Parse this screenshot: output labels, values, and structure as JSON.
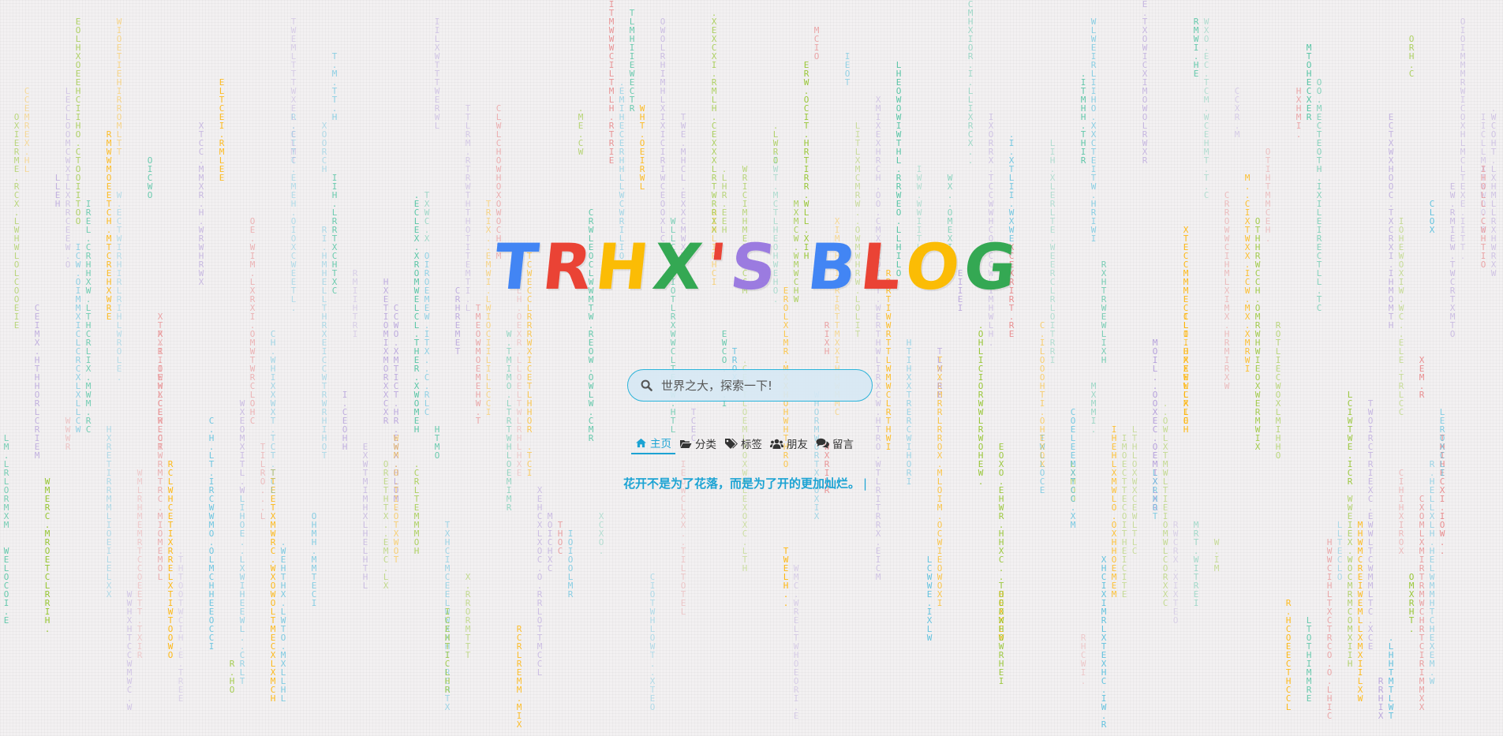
{
  "logo": {
    "letters": [
      {
        "ch": "T",
        "color": "#4285f4"
      },
      {
        "ch": "R",
        "color": "#ea4335"
      },
      {
        "ch": "H",
        "color": "#fbbc05"
      },
      {
        "ch": "X",
        "color": "#34a853"
      },
      {
        "ch": "'",
        "color": "#ea4335"
      },
      {
        "ch": "S",
        "color": "#9b7be0"
      },
      {
        "ch": " ",
        "color": "#000000"
      },
      {
        "ch": "B",
        "color": "#4285f4"
      },
      {
        "ch": "L",
        "color": "#ea4335"
      },
      {
        "ch": "O",
        "color": "#fbbc05"
      },
      {
        "ch": "G",
        "color": "#34a853"
      }
    ]
  },
  "search": {
    "placeholder": "世界之大，探索一下!",
    "icon": "search-icon"
  },
  "nav": {
    "items": [
      {
        "label": "主页",
        "icon": "home-icon",
        "active": true
      },
      {
        "label": "分类",
        "icon": "folder-open-icon",
        "active": false
      },
      {
        "label": "标签",
        "icon": "tags-icon",
        "active": false
      },
      {
        "label": "朋友",
        "icon": "users-icon",
        "active": false
      },
      {
        "label": "留言",
        "icon": "comments-icon",
        "active": false
      }
    ]
  },
  "motto": {
    "text": "花开不是为了花落，而是为了开的更加灿烂。",
    "cursor": "|"
  },
  "colors": {
    "accent": "#1ca3d3",
    "background": "#f3f1f2",
    "rain_palette": [
      "#8dc21f",
      "#5bc0de",
      "#e8888a",
      "#b39ddb",
      "#ffb300",
      "#4fc3a1"
    ]
  }
}
